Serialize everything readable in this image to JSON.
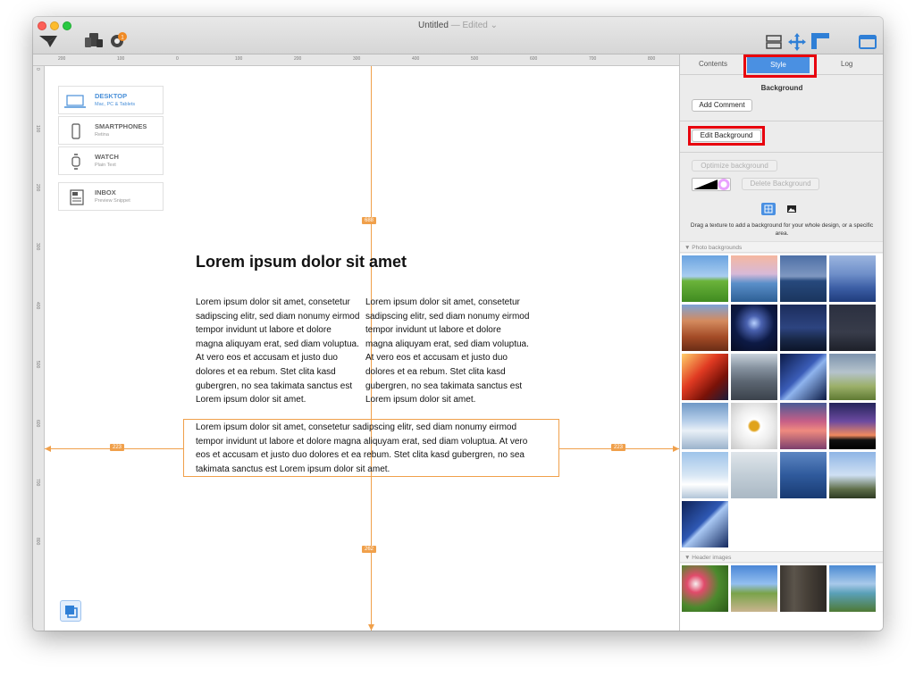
{
  "window": {
    "title": "Untitled",
    "title_suffix": "— Edited ⌄"
  },
  "toolbar": {
    "left_icons": [
      "paper-plane-icon",
      "devices-icon",
      "notification-badge-icon"
    ],
    "right_icons": [
      "layout-icon",
      "move-arrows-icon",
      "ruler-icon",
      "panel-toggle-icon"
    ]
  },
  "rulers": {
    "top_labels": [
      "200",
      "100",
      "0",
      "100",
      "200",
      "300",
      "400",
      "500",
      "600",
      "700",
      "800"
    ],
    "left_labels": [
      "0",
      "100",
      "200",
      "300",
      "400",
      "500",
      "600",
      "700",
      "800"
    ]
  },
  "devices": [
    {
      "name": "DESKTOP",
      "sub": "Mac, PC & Tablets",
      "icon": "laptop-icon",
      "active": true
    },
    {
      "name": "SMARTPHONES",
      "sub": "Retina",
      "icon": "smartphone-icon",
      "active": false
    },
    {
      "name": "WATCH",
      "sub": "Plain Text",
      "icon": "watch-icon",
      "active": false
    },
    {
      "name": "INBOX",
      "sub": "Preview Snippet",
      "icon": "inbox-icon",
      "active": false
    }
  ],
  "content": {
    "headline": "Lorem ipsum dolor sit amet",
    "col_left": "Lorem ipsum dolor sit amet, consetetur sadipscing elitr, sed diam nonumy eirmod tempor invidunt ut labore et dolore magna aliquyam erat, sed diam voluptua. At vero eos et accusam et justo duo dolores et ea rebum. Stet clita kasd gubergren, no sea takimata sanctus est Lorem ipsum dolor sit amet.",
    "col_right": "Lorem ipsum dolor sit amet, consetetur sadipscing elitr, sed diam nonumy eirmod tempor invidunt ut labore et dolore magna aliquyam erat, sed diam voluptua. At vero eos et accusam et justo duo dolores et ea rebum. Stet clita kasd gubergren, no sea takimata sanctus est Lorem ipsum dolor sit amet.",
    "selected_text": "Lorem ipsum dolor sit amet, consetetur sadipscing elitr, sed diam nonumy eirmod tempor invidunt ut labore et dolore magna aliquyam erat, sed diam voluptua. At vero eos et accusam et justo duo dolores et ea rebum. Stet clita kasd gubergren, no sea takimata sanctus est Lorem ipsum dolor sit amet."
  },
  "guides": {
    "top": "688",
    "bottom": "262",
    "left": "223",
    "right": "223"
  },
  "panel": {
    "tabs": {
      "contents": "Contents",
      "style": "Style",
      "log": "Log"
    },
    "section_title": "Background",
    "add_comment": "Add Comment",
    "edit_background": "Edit Background",
    "optimize_background": "Optimize background",
    "delete_background": "Delete Background",
    "drag_hint": "Drag a texture to add a background for your whole design, or a specific area.",
    "photo_backgrounds_label": "Photo backgrounds",
    "header_images_label": "Header images",
    "photo_thumbs": [
      "green-hills",
      "pink-sunset-sea",
      "blue-ocean-horizon",
      "misty-blue-mountains",
      "red-rock-canyon",
      "fireworks-night",
      "starry-night-mountains",
      "dark-night-sky",
      "red-phone-booth-lights",
      "pebble-beach",
      "milky-way",
      "dandelion-field",
      "snowy-bridge",
      "white-daisy",
      "pink-dusk-clouds",
      "purple-sunset-ridge",
      "sea-of-clouds",
      "frosted-forest",
      "deep-blue-water",
      "palm-trees",
      "milky-way-blue"
    ],
    "header_thumbs": [
      "flower-meadow",
      "country-road",
      "wood-texture",
      "lake-landscape"
    ],
    "accent_color": "#4a90e2",
    "guide_color": "#f0a04b",
    "highlight_color": "#e8000d"
  }
}
